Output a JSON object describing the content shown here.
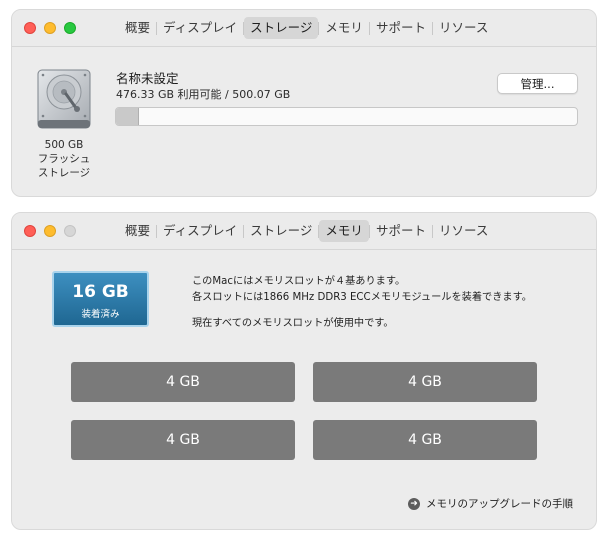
{
  "tabs": [
    "概要",
    "ディスプレイ",
    "ストレージ",
    "メモリ",
    "サポート",
    "リソース"
  ],
  "storage_window": {
    "active_tab": "ストレージ",
    "disk": {
      "icon": "hard-drive-icon",
      "caption_line1": "500 GB",
      "caption_line2": "フラッシュ",
      "caption_line3": "ストレージ"
    },
    "volume": {
      "name": "名称未設定",
      "usage": "476.33 GB 利用可能 / 500.07 GB",
      "used_fraction": 0.048
    },
    "manage_button": "管理..."
  },
  "memory_window": {
    "active_tab": "メモリ",
    "installed": {
      "size": "16 GB",
      "label": "装着済み",
      "color": "#2b7aab"
    },
    "description": {
      "line1": "このMacにはメモリスロットが４基あります。",
      "line2": "各スロットには1866 MHz DDR3 ECCメモリモジュールを装着できます。",
      "line3": "現在すべてのメモリスロットが使用中です。"
    },
    "slots": [
      "4 GB",
      "4 GB",
      "4 GB",
      "4 GB"
    ],
    "upgrade_link": "メモリのアップグレードの手順"
  }
}
